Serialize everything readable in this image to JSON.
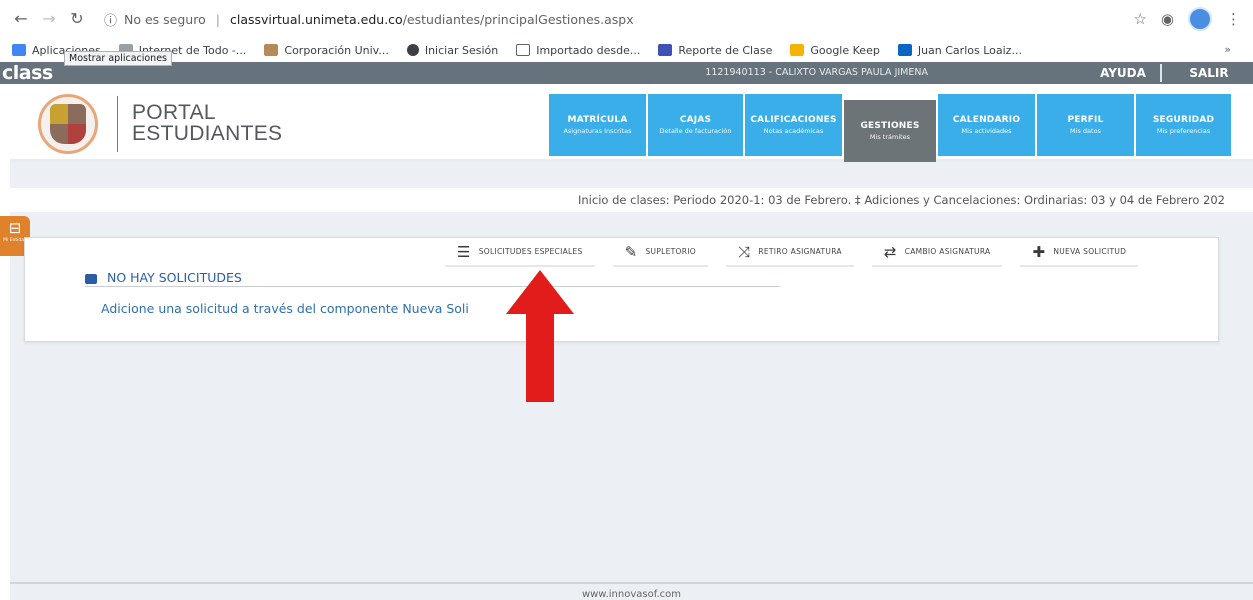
{
  "browser": {
    "info_label": "No es seguro",
    "url_domain": "classvirtual.unimeta.edu.co",
    "url_path": "/estudiantes/principalGestiones.aspx",
    "bookmarks": [
      {
        "label": "Aplicaciones",
        "color": "#4285f4"
      },
      {
        "label": "Internet de Todo -...",
        "color": "#9aa0a6"
      },
      {
        "label": "Corporación Univ...",
        "color": "#b58a5b"
      },
      {
        "label": "Iniciar Sesión",
        "color": "#3c4043"
      },
      {
        "label": "Importado desde...",
        "color": "#9aa0a6"
      },
      {
        "label": "Reporte de Clase",
        "color": "#3f51b5"
      },
      {
        "label": "Google Keep",
        "color": "#f4b400"
      },
      {
        "label": "Juan Carlos Loaiz...",
        "color": "#0a66c2"
      }
    ],
    "tooltip": "Mostrar aplicaciones",
    "more_label": "»"
  },
  "topbar": {
    "logo": "class",
    "user": "1121940113 - CALIXTO VARGAS PAULA JIMENA",
    "ayuda": "AYUDA",
    "salir": "SALIR"
  },
  "header": {
    "title_line1": "PORTAL",
    "title_line2": "ESTUDIANTES",
    "menu": [
      {
        "title": "MATRÍCULA",
        "subtitle": "Asignaturas Inscritas",
        "active": false
      },
      {
        "title": "CAJAS",
        "subtitle": "Detalle de facturación",
        "active": false
      },
      {
        "title": "CALIFICACIONES",
        "subtitle": "Notas académicas",
        "active": false
      },
      {
        "title": "GESTIONES",
        "subtitle": "Mis trámites",
        "active": true
      },
      {
        "title": "CALENDARIO",
        "subtitle": "Mis actividades",
        "active": false
      },
      {
        "title": "PERFIL",
        "subtitle": "Mis datos",
        "active": false
      },
      {
        "title": "SEGURIDAD",
        "subtitle": "Mis preferencias",
        "active": false
      }
    ]
  },
  "notice": "Inicio de clases:   Periodo 2020-1: 03 de Febrero.  ‡  Adiciones y Cancelaciones:   Ordinarias: 03 y 04 de Febrero 202",
  "side_tab_label": "Mi Entidad",
  "panel": {
    "tabs": [
      {
        "label": "SOLICITUDES ESPECIALES",
        "icon": "list-icon"
      },
      {
        "label": "SUPLETORIO",
        "icon": "edit-icon"
      },
      {
        "label": "RETIRO ASIGNATURA",
        "icon": "shuffle-icon"
      },
      {
        "label": "CAMBIO ASIGNATURA",
        "icon": "swap-icon"
      },
      {
        "label": "NUEVA SOLICITUD",
        "icon": "plus-icon"
      }
    ],
    "empty_title": "NO HAY SOLICITUDES",
    "hint": "Adicione una solicitud a través del componente Nueva Soli"
  },
  "footer": "www.innovasof.com",
  "colors": {
    "menu_blue": "#39aee8",
    "menu_active": "#6d7478",
    "topbar": "#66727c",
    "arrow": "#e21b1b",
    "link_blue": "#2f6fb0"
  }
}
